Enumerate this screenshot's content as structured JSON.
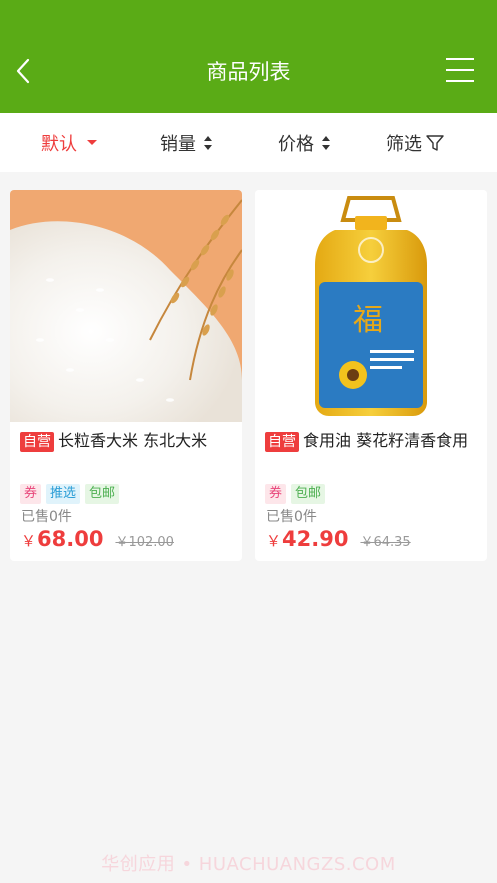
{
  "header": {
    "title": "商品列表",
    "back_icon": "chevron-left-icon",
    "menu_icon": "hamburger-menu-icon"
  },
  "filters": {
    "default_label": "默认",
    "sales_label": "销量",
    "price_label": "价格",
    "filter_label": "筛选"
  },
  "products": [
    {
      "badge": "自营",
      "title": "长粒香大米 东北大米",
      "tags": [
        "券",
        "推选",
        "包邮"
      ],
      "sold": "已售0件",
      "currency": "￥",
      "price": "68.00",
      "original_price": "￥102.00"
    },
    {
      "badge": "自营",
      "title": "食用油 葵花籽清香食用",
      "tags": [
        "券",
        "包邮"
      ],
      "sold": "已售0件",
      "currency": "￥",
      "price": "42.90",
      "original_price": "￥64.35"
    }
  ],
  "watermark": "华创应用 • HUACHUANGZS.COM",
  "colors": {
    "header": "#5aab16",
    "accent_red": "#ee3d3d"
  }
}
